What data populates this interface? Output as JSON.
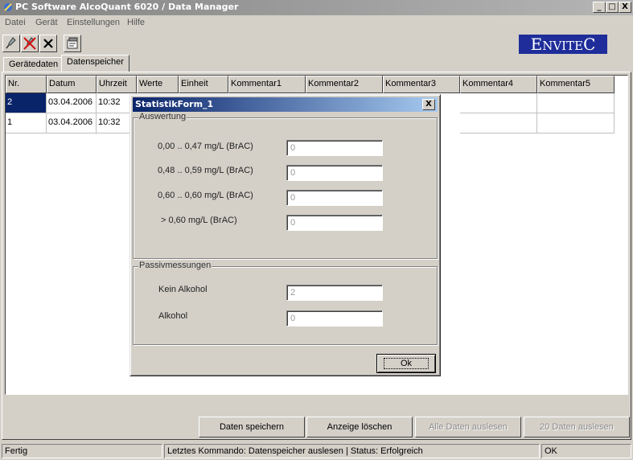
{
  "window": {
    "title": "PC Software AlcoQuant 6020  / Data Manager",
    "btn_min": "_",
    "btn_max": "□",
    "btn_close": "X"
  },
  "menu": [
    "Datei",
    "Gerät",
    "Einstellungen",
    "Hilfe"
  ],
  "toolbar_icons": [
    "connect-icon",
    "disconnect-icon",
    "delete-icon",
    "properties-icon"
  ],
  "logo": {
    "first": "E",
    "rest": "NVITE",
    "last": "C"
  },
  "tabs": [
    {
      "label": "Gerätedaten",
      "active": false
    },
    {
      "label": "Datenspeicher",
      "active": true
    }
  ],
  "table": {
    "columns": [
      "Nr.",
      "Datum",
      "Uhrzeit",
      "Werte",
      "Einheit",
      "Kommentar1",
      "Kommentar2",
      "Kommentar3",
      "Kommentar4",
      "Kommentar5"
    ],
    "rows": [
      {
        "nr": "2",
        "datum": "03.04.2006",
        "uhrzeit": "10:32"
      },
      {
        "nr": "1",
        "datum": "03.04.2006",
        "uhrzeit": "10:32"
      }
    ]
  },
  "dialog": {
    "title": "StatistikForm_1",
    "close": "X",
    "auswertung": {
      "label": "Auswertung",
      "items": [
        {
          "label": "0,00 .. 0,47 mg/L (BrAC)",
          "value": "0"
        },
        {
          "label": "0,48 .. 0,59 mg/L (BrAC)",
          "value": "0"
        },
        {
          "label": "0,60 .. 0,60 mg/L (BrAC)",
          "value": "0"
        },
        {
          "label": "> 0,60 mg/L (BrAC)",
          "value": "0"
        }
      ]
    },
    "passiv": {
      "label": "Passivmessungen",
      "items": [
        {
          "label": "Kein Alkohol",
          "value": "2"
        },
        {
          "label": "Alkohol",
          "value": "0"
        }
      ]
    },
    "ok": "Ok"
  },
  "buttons": {
    "save": "Daten speichern",
    "clear": "Anzeige löschen",
    "read_all": "Alle Daten auslesen",
    "read_20": "20 Daten auslesen"
  },
  "status": {
    "state": "Fertig",
    "message": "Letztes Kommando: Datenspeicher auslesen | Status: Erfolgreich",
    "result": "OK"
  },
  "colors": {
    "selection": "#0a246a",
    "logo_bg": "#1e2d9a"
  }
}
